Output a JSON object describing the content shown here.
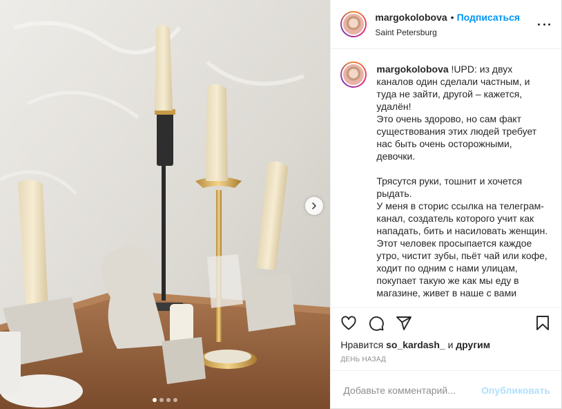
{
  "post": {
    "username": "margokolobova",
    "bullet": "•",
    "follow_label": "Подписаться",
    "location": "Saint Petersburg",
    "more_icon": "more-horizontal-icon",
    "caption": "!UPD: из двух каналов один сделали частным, и туда не зайти, другой – кажется, удалён!\nЭто очень здорово, но сам факт существования этих людей требует нас быть очень осторожными, девочки.\n\nТрясутся руки, тошнит и хочется рыдать.\nУ меня в сторис ссылка на телеграм-канал, создатель которого учит как нападать, бить и насиловать женщин.\nЭтот человек просыпается каждое утро, чистит зубы, пьёт чай или кофе, ходит по одним с нами улицам, покупает такую же как мы еду в магазине, живет в наше с вами",
    "likes_prefix": "Нравится",
    "likes_user": "so_kardash_",
    "likes_suffix": "и",
    "likes_others": "другим",
    "time": "ДЕНЬ НАЗАД",
    "comment_placeholder": "Добавьте комментарий...",
    "publish_label": "Опубликовать"
  },
  "carousel": {
    "dots_total": 4,
    "active_dot": 0
  },
  "icons": {
    "like": "heart-icon",
    "comment": "comment-icon",
    "share": "paper-plane-icon",
    "save": "bookmark-icon",
    "next": "chevron-right-icon"
  },
  "colors": {
    "accent": "#0095f6",
    "publish_disabled": "#b2dffc",
    "muted": "#8e8e8e"
  }
}
